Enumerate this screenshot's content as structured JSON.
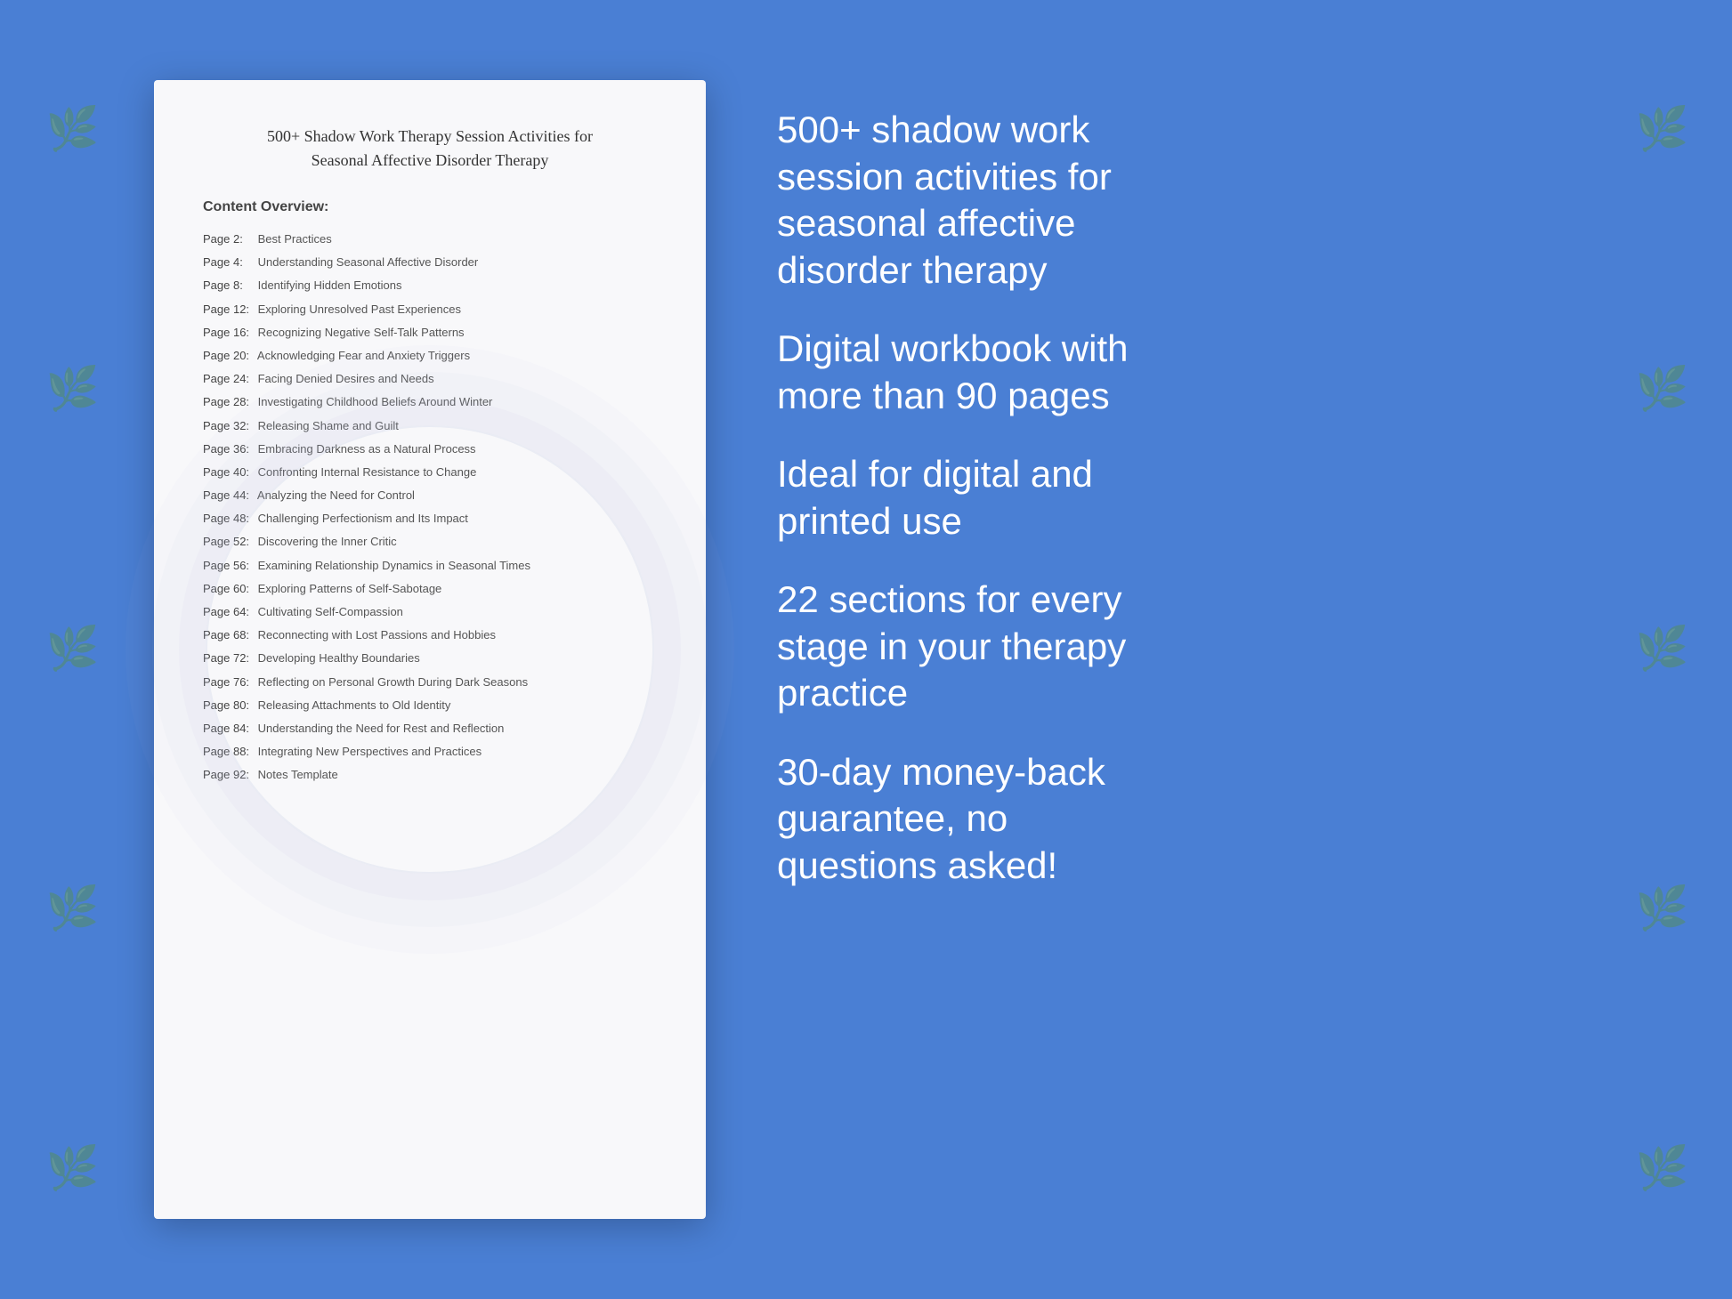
{
  "background_color": "#4a7fd4",
  "document": {
    "title_line1": "500+ Shadow Work Therapy Session Activities for",
    "title_line2": "Seasonal Affective Disorder Therapy",
    "toc_header": "Content Overview:",
    "toc_items": [
      {
        "page": "Page  2:",
        "title": "Best Practices"
      },
      {
        "page": "Page  4:",
        "title": "Understanding Seasonal Affective Disorder"
      },
      {
        "page": "Page  8:",
        "title": "Identifying Hidden Emotions"
      },
      {
        "page": "Page 12:",
        "title": "Exploring Unresolved Past Experiences"
      },
      {
        "page": "Page 16:",
        "title": "Recognizing Negative Self-Talk Patterns"
      },
      {
        "page": "Page 20:",
        "title": "Acknowledging Fear and Anxiety Triggers"
      },
      {
        "page": "Page 24:",
        "title": "Facing Denied Desires and Needs"
      },
      {
        "page": "Page 28:",
        "title": "Investigating Childhood Beliefs Around Winter"
      },
      {
        "page": "Page 32:",
        "title": "Releasing Shame and Guilt"
      },
      {
        "page": "Page 36:",
        "title": "Embracing Darkness as a Natural Process"
      },
      {
        "page": "Page 40:",
        "title": "Confronting Internal Resistance to Change"
      },
      {
        "page": "Page 44:",
        "title": "Analyzing the Need for Control"
      },
      {
        "page": "Page 48:",
        "title": "Challenging Perfectionism and Its Impact"
      },
      {
        "page": "Page 52:",
        "title": "Discovering the Inner Critic"
      },
      {
        "page": "Page 56:",
        "title": "Examining Relationship Dynamics in Seasonal Times"
      },
      {
        "page": "Page 60:",
        "title": "Exploring Patterns of Self-Sabotage"
      },
      {
        "page": "Page 64:",
        "title": "Cultivating Self-Compassion"
      },
      {
        "page": "Page 68:",
        "title": "Reconnecting with Lost Passions and Hobbies"
      },
      {
        "page": "Page 72:",
        "title": "Developing Healthy Boundaries"
      },
      {
        "page": "Page 76:",
        "title": "Reflecting on Personal Growth During Dark Seasons"
      },
      {
        "page": "Page 80:",
        "title": "Releasing Attachments to Old Identity"
      },
      {
        "page": "Page 84:",
        "title": "Understanding the Need for Rest and Reflection"
      },
      {
        "page": "Page 88:",
        "title": "Integrating New Perspectives and Practices"
      },
      {
        "page": "Page 92:",
        "title": "Notes Template"
      }
    ]
  },
  "features": [
    "500+ shadow work\nsession activities for\nseasonal affective\ndisorder therapy",
    "Digital workbook with\nmore than 90 pages",
    "Ideal for digital and\nprinted use",
    "22 sections for every\nstage in your therapy\npractice",
    "30-day money-back\nguarantee, no\nquestions asked!"
  ],
  "floral_icons": [
    "❀",
    "✿",
    "❁",
    "✾",
    "❀",
    "✿",
    "❁",
    "✾",
    "❀",
    "✿"
  ]
}
